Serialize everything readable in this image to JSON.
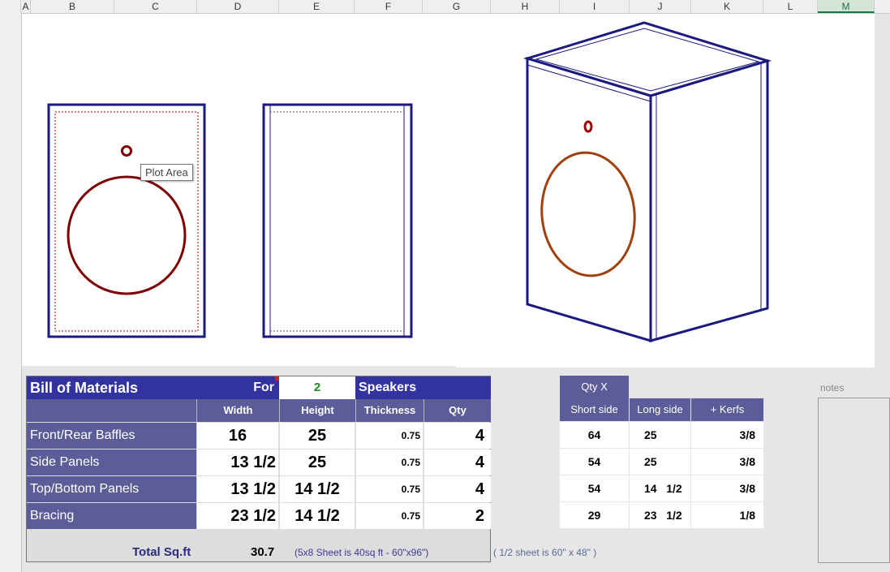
{
  "columns": [
    "A",
    "B",
    "C",
    "D",
    "E",
    "F",
    "G",
    "H",
    "I",
    "J",
    "K",
    "L",
    "M"
  ],
  "selected_column": "M",
  "tooltip": "Plot Area",
  "bom": {
    "title": "Bill of Materials",
    "for_label": "For",
    "for_value": "2",
    "speakers_label": "Speakers",
    "headers": [
      "Width",
      "Height",
      "Thickness",
      "Qty"
    ],
    "rows": [
      {
        "label": "Front/Rear Baffles",
        "width": "16",
        "height": "25",
        "thickness": "0.75",
        "qty": "4"
      },
      {
        "label": "Side Panels",
        "width": "13 1/2",
        "height": "25",
        "thickness": "0.75",
        "qty": "4"
      },
      {
        "label": "Top/Bottom Panels",
        "width": "13 1/2",
        "height": "14 1/2",
        "thickness": "0.75",
        "qty": "4"
      },
      {
        "label": "Bracing",
        "width": "23 1/2",
        "height": "14 1/2",
        "thickness": "0.75",
        "qty": "2"
      }
    ],
    "total_label": "Total Sq.ft",
    "total_value": "30.7",
    "sheet_note": "(5x8 Sheet is 40sq ft - 60\"x96\")",
    "half_sheet_note": "( 1/2 sheet is 60\" x 48\" )"
  },
  "qty_table": {
    "title": "Qty  X",
    "headers": [
      "Short side",
      "Long side",
      "+ Kerfs"
    ],
    "rows": [
      {
        "short": "64",
        "long": "25",
        "kerf": "3/8"
      },
      {
        "short": "54",
        "long": "25",
        "kerf": "3/8"
      },
      {
        "short": "54",
        "long": "14   1/2",
        "kerf": "3/8"
      },
      {
        "short": "29",
        "long": "23   1/2",
        "kerf": "1/8"
      }
    ]
  },
  "notes_label": "notes",
  "colors": {
    "panel_outline": "#1a1a80",
    "driver_outline": "#800000",
    "iso_driver": "#a0400c",
    "header_blue": "#3232a0",
    "header_purple": "#5c5c98",
    "speaker_count": "#1a8a1a"
  }
}
